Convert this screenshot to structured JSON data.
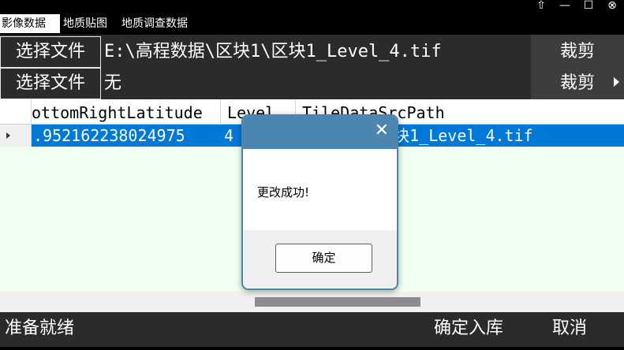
{
  "tabs": [
    {
      "label": "影像数据",
      "active": true
    },
    {
      "label": "地质贴图",
      "active": false
    },
    {
      "label": "地质调查数据",
      "active": false
    }
  ],
  "window_controls": {
    "icon1": "⇧",
    "minimize": "—",
    "maximize": "☐",
    "close": "⊗"
  },
  "file_rows": [
    {
      "button_label": "选择文件",
      "path": "E:\\高程数据\\区块1\\区块1_Level_4.tif"
    },
    {
      "button_label": "选择文件",
      "path": "无"
    }
  ],
  "crop_buttons": [
    "裁剪",
    "裁剪"
  ],
  "grid": {
    "columns": [
      "ottomRightLatitude",
      "Level",
      "TileDataSrcPath"
    ],
    "rows": [
      {
        "cells": [
          ".952162238024975",
          "4",
          "据\\区块1\\区块1_Level_4.tif"
        ]
      }
    ]
  },
  "status": {
    "text": "准备就绪",
    "confirm_label": "确定入库",
    "cancel_label": "取消"
  },
  "dialog": {
    "close": "✕",
    "message": "更改成功!",
    "ok_label": "确定"
  },
  "colors": {
    "accent": "#0078d7",
    "dialog_title": "#4a86b0",
    "grid_bg": "#f0fff0",
    "panel_bg": "#2b2b2b"
  }
}
